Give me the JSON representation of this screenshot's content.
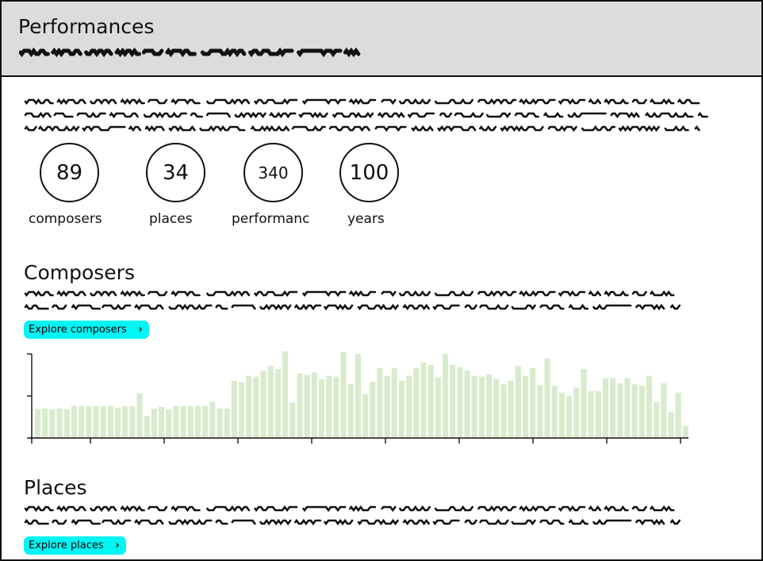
{
  "header": {
    "title": "Performances"
  },
  "stats": [
    {
      "value": "89",
      "label": "composers"
    },
    {
      "value": "34",
      "label": "places"
    },
    {
      "value": "340",
      "label": "performanc"
    },
    {
      "value": "100",
      "label": "years"
    }
  ],
  "composers": {
    "heading": "Composers",
    "button_label": "Explore composers"
  },
  "places": {
    "heading": "Places",
    "button_label": "Explore places"
  },
  "icons": {
    "button_chevron": "chevron-right-icon"
  },
  "colors": {
    "accent": "#00f5f5",
    "bar": "#d9ebcd",
    "header_bg": "#dcdcdc"
  },
  "chart_data": {
    "type": "bar",
    "title": "",
    "xlabel": "",
    "ylabel": "",
    "grid": false,
    "ylim": [
      0,
      100
    ],
    "values": [
      35,
      35,
      34,
      35,
      34,
      38,
      38,
      38,
      38,
      38,
      38,
      36,
      38,
      38,
      53,
      26,
      35,
      37,
      34,
      38,
      38,
      38,
      38,
      38,
      43,
      35,
      35,
      68,
      66,
      74,
      73,
      80,
      86,
      82,
      103,
      42,
      77,
      75,
      78,
      70,
      74,
      73,
      102,
      64,
      100,
      52,
      67,
      83,
      74,
      83,
      68,
      74,
      83,
      90,
      87,
      72,
      100,
      87,
      84,
      80,
      74,
      73,
      76,
      70,
      64,
      68,
      86,
      74,
      83,
      63,
      95,
      62,
      54,
      50,
      60,
      82,
      56,
      56,
      71,
      71,
      65,
      71,
      64,
      62,
      74,
      43,
      65,
      31,
      54,
      14
    ]
  }
}
